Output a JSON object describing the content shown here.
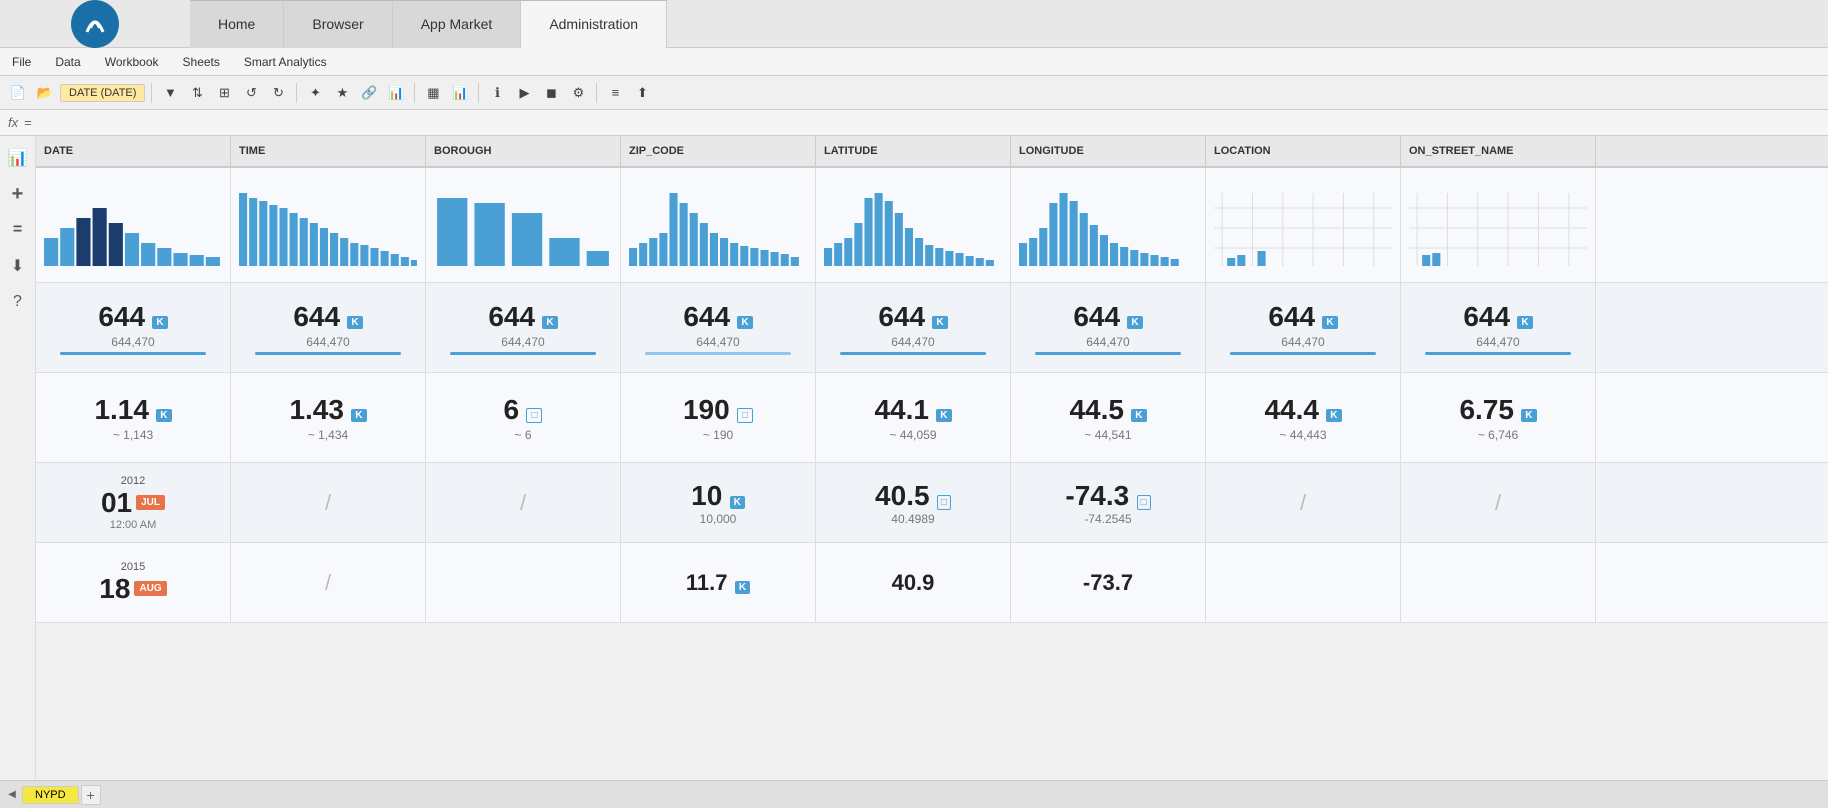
{
  "nav": {
    "tabs": [
      {
        "label": "Home",
        "active": false
      },
      {
        "label": "Browser",
        "active": false
      },
      {
        "label": "App Market",
        "active": false
      },
      {
        "label": "Administration",
        "active": true
      }
    ]
  },
  "menu": {
    "items": [
      "File",
      "Data",
      "Workbook",
      "Sheets",
      "Smart Analytics"
    ]
  },
  "formula_bar": {
    "icon": "fx",
    "eq": "="
  },
  "toolbar": {
    "tooltip": "DATE (DATE)"
  },
  "columns": [
    {
      "name": "DATE"
    },
    {
      "name": "TIME"
    },
    {
      "name": "BOROUGH"
    },
    {
      "name": "ZIP_CODE"
    },
    {
      "name": "LATITUDE"
    },
    {
      "name": "LONGITUDE"
    },
    {
      "name": "LOCATION"
    },
    {
      "name": "ON_STREET_NAME"
    }
  ],
  "stats_row1": {
    "cells": [
      {
        "number": "644",
        "badge": "K",
        "sub": "644,470"
      },
      {
        "number": "644",
        "badge": "K",
        "sub": "644,470"
      },
      {
        "number": "644",
        "badge": "K",
        "sub": "644,470"
      },
      {
        "number": "644",
        "badge": "K",
        "sub": "644,470"
      },
      {
        "number": "644",
        "badge": "K",
        "sub": "644,470"
      },
      {
        "number": "644",
        "badge": "K",
        "sub": "644,470"
      },
      {
        "number": "644",
        "badge": "K",
        "sub": "644,470"
      },
      {
        "number": "644",
        "badge": "K",
        "sub": "644,470"
      }
    ]
  },
  "stats_row2": {
    "cells": [
      {
        "number": "1.14",
        "badge": "K",
        "badge_type": "filled",
        "sub": "~ 1,143"
      },
      {
        "number": "1.43",
        "badge": "K",
        "badge_type": "filled",
        "sub": "~ 1,434"
      },
      {
        "number": "6",
        "badge": "",
        "badge_type": "outline",
        "sub": "~ 6"
      },
      {
        "number": "190",
        "badge": "",
        "badge_type": "outline",
        "sub": "~ 190"
      },
      {
        "number": "44.1",
        "badge": "K",
        "badge_type": "filled",
        "sub": "~ 44,059"
      },
      {
        "number": "44.5",
        "badge": "K",
        "badge_type": "filled",
        "sub": "~ 44,541"
      },
      {
        "number": "44.4",
        "badge": "K",
        "badge_type": "filled",
        "sub": "~ 44,443"
      },
      {
        "number": "6.75",
        "badge": "K",
        "badge_type": "filled",
        "sub": "~ 6,746"
      }
    ]
  },
  "data_row1": {
    "date_year": "2012",
    "date_day": "01",
    "date_month_badge": "JUL",
    "date_time": "12:00 AM",
    "zip_number": "10",
    "zip_badge": "K",
    "zip_sub": "10,000",
    "lat_number": "40.5",
    "lat_badge_type": "outline",
    "lat_sub": "40.4989",
    "lon_number": "-74.3",
    "lon_badge_type": "outline",
    "lon_sub": "-74.2545"
  },
  "data_row2": {
    "date_year": "2015",
    "date_day": "18",
    "date_month_badge": "AUG"
  },
  "bottom": {
    "sheet_name": "NYPD",
    "add_label": "+"
  }
}
